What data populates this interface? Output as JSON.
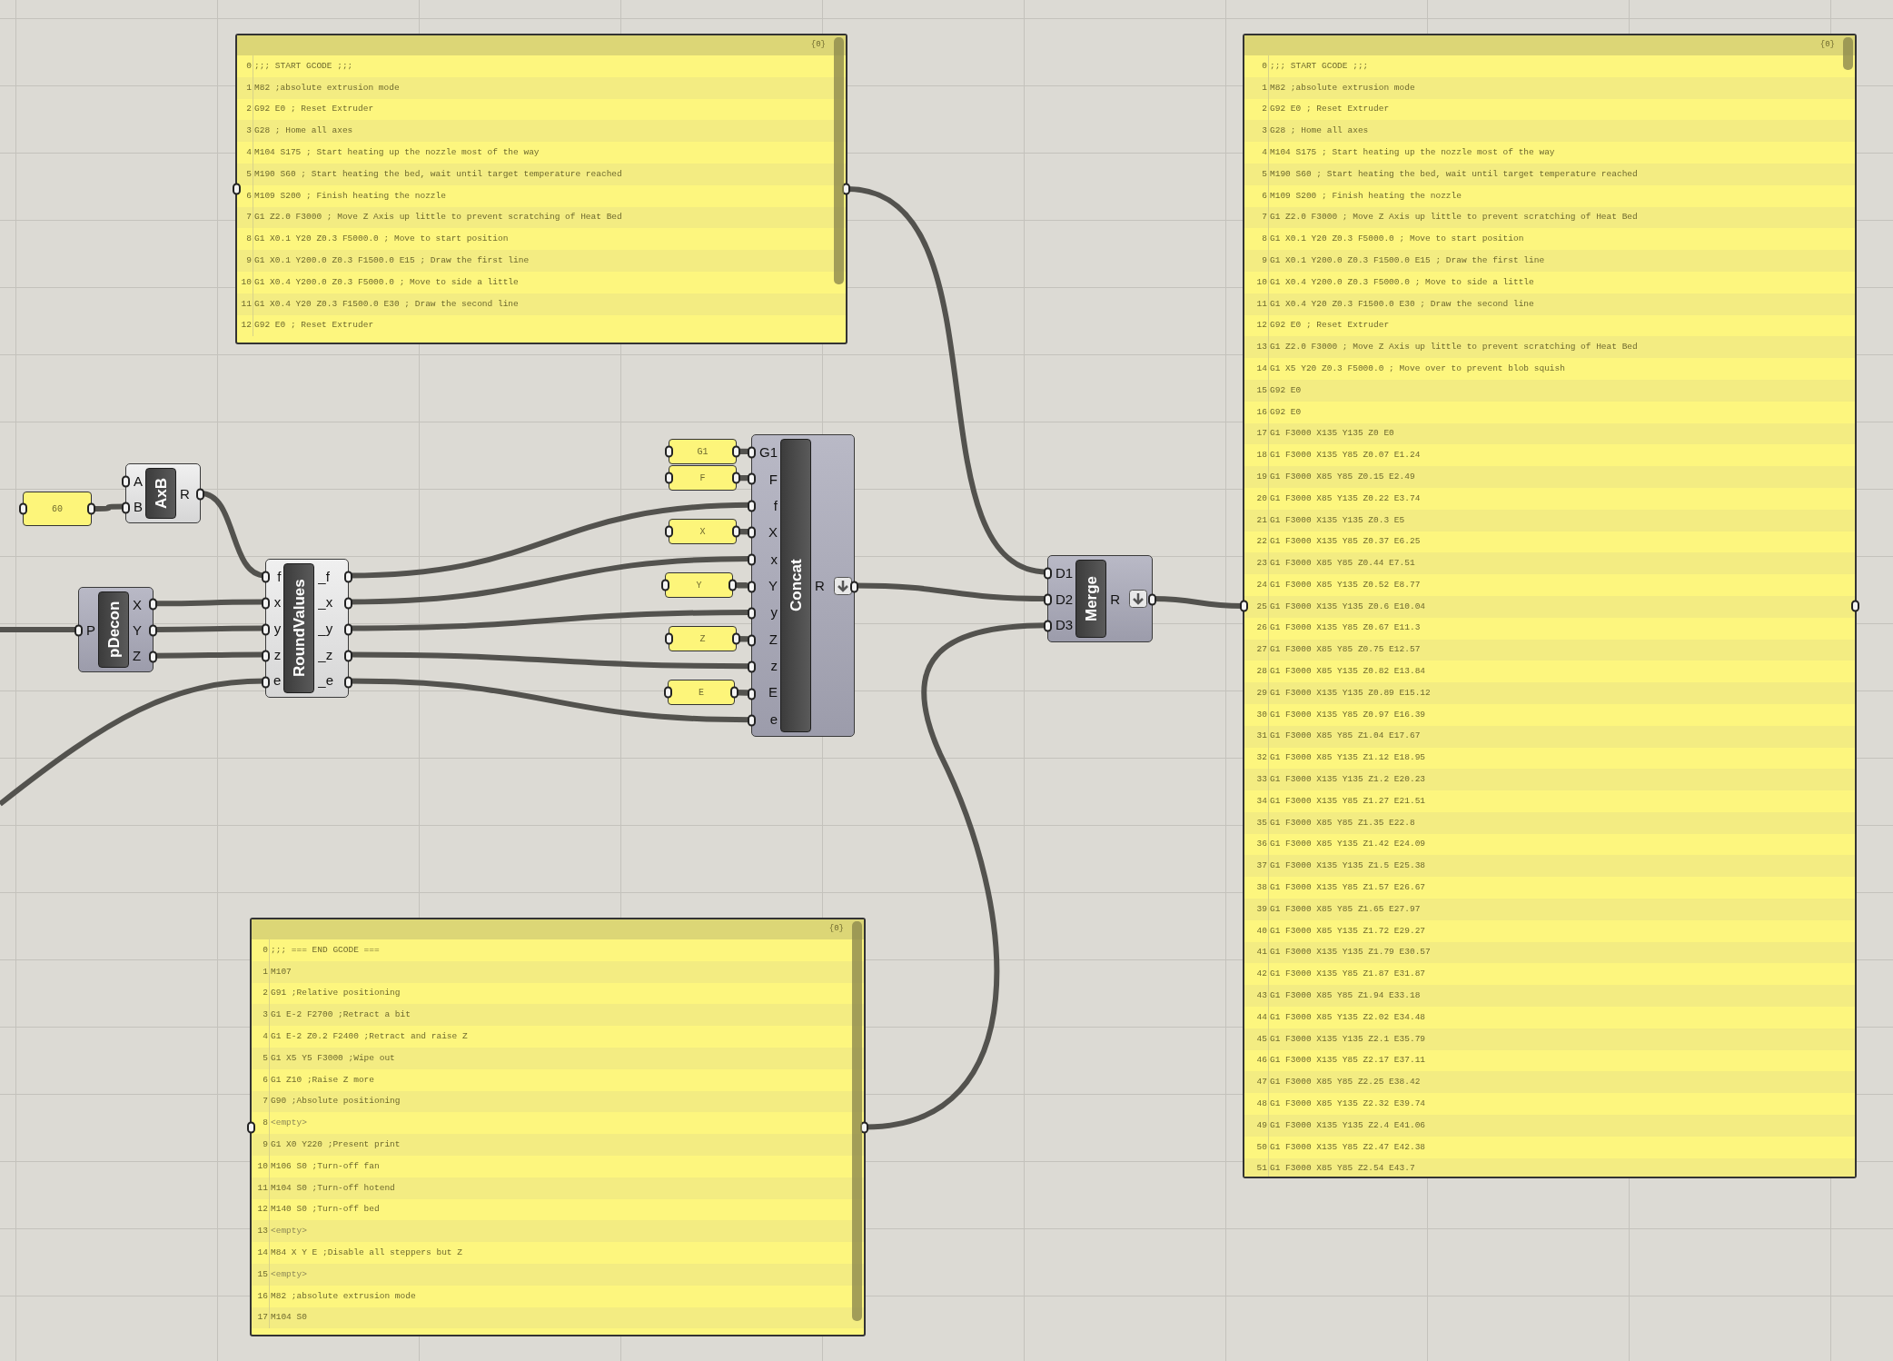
{
  "canvas": {
    "value_panels": [
      {
        "text": "60"
      },
      {
        "text": "G1"
      },
      {
        "text": "F"
      },
      {
        "text": "X"
      },
      {
        "text": "Y"
      },
      {
        "text": "Z"
      },
      {
        "text": "E"
      }
    ],
    "components": [
      {
        "name": "AxB",
        "kind": "light",
        "flatten": false,
        "inputs": [
          "A",
          "B"
        ],
        "outputs": [
          "R"
        ]
      },
      {
        "name": "pDecon",
        "kind": "dark",
        "flatten": false,
        "inputs": [
          "P"
        ],
        "outputs": [
          "X",
          "Y",
          "Z"
        ]
      },
      {
        "name": "RoundValues",
        "kind": "light",
        "flatten": false,
        "inputs": [
          "f",
          "x",
          "y",
          "z",
          "e"
        ],
        "outputs": [
          "_f",
          "_x",
          "_y",
          "_z",
          "_e"
        ]
      },
      {
        "name": "Concat",
        "kind": "dark",
        "flatten": true,
        "inputs": [
          "G1",
          "F",
          "f",
          "X",
          "x",
          "Y",
          "y",
          "Z",
          "z",
          "E",
          "e"
        ],
        "outputs": [
          "R"
        ]
      },
      {
        "name": "Merge",
        "kind": "dark",
        "flatten": true,
        "inputs": [
          "D1",
          "D2",
          "D3"
        ],
        "outputs": [
          "R"
        ]
      }
    ],
    "text_panels": [
      {
        "header": "{0}",
        "lines": [
          {
            "index": "0",
            "text": ";;; START GCODE ;;;",
            "kind": "code"
          },
          {
            "index": "1",
            "text": "M82 ;absolute extrusion mode",
            "kind": "code"
          },
          {
            "index": "2",
            "text": "G92 E0 ; Reset Extruder",
            "kind": "code"
          },
          {
            "index": "3",
            "text": "G28 ; Home all axes",
            "kind": "code"
          },
          {
            "index": "4",
            "text": "M104 S175 ; Start heating up the nozzle most of the way",
            "kind": "code"
          },
          {
            "index": "5",
            "text": "M190 S60 ; Start heating the bed, wait until target temperature reached",
            "kind": "code"
          },
          {
            "index": "6",
            "text": "M109 S200 ; Finish heating the nozzle",
            "kind": "code"
          },
          {
            "index": "7",
            "text": "G1 Z2.0 F3000 ; Move Z Axis up little to prevent scratching of Heat Bed",
            "kind": "code"
          },
          {
            "index": "8",
            "text": "G1 X0.1 Y20 Z0.3 F5000.0 ; Move to start position",
            "kind": "code"
          },
          {
            "index": "9",
            "text": "G1 X0.1 Y200.0 Z0.3 F1500.0 E15 ; Draw the first line",
            "kind": "code"
          },
          {
            "index": "10",
            "text": "G1 X0.4 Y200.0 Z0.3 F5000.0 ; Move to side a little",
            "kind": "code"
          },
          {
            "index": "11",
            "text": "G1 X0.4 Y20 Z0.3 F1500.0 E30 ; Draw the second line",
            "kind": "code"
          },
          {
            "index": "12",
            "text": "G92 E0 ; Reset Extruder",
            "kind": "code"
          }
        ]
      },
      {
        "header": "{0}",
        "lines": [
          {
            "index": "0",
            "text": ";;; START GCODE ;;;",
            "kind": "code"
          },
          {
            "index": "1",
            "text": "M82 ;absolute extrusion mode",
            "kind": "code"
          },
          {
            "index": "2",
            "text": "G92 E0 ; Reset Extruder",
            "kind": "code"
          },
          {
            "index": "3",
            "text": "G28 ; Home all axes",
            "kind": "code"
          },
          {
            "index": "4",
            "text": "M104 S175 ; Start heating up the nozzle most of the way",
            "kind": "code"
          },
          {
            "index": "5",
            "text": "M190 S60 ; Start heating the bed, wait until target temperature reached",
            "kind": "code"
          },
          {
            "index": "6",
            "text": "M109 S200 ; Finish heating the nozzle",
            "kind": "code"
          },
          {
            "index": "7",
            "text": "G1 Z2.0 F3000 ; Move Z Axis up little to prevent scratching of Heat Bed",
            "kind": "code"
          },
          {
            "index": "8",
            "text": "G1 X0.1 Y20 Z0.3 F5000.0 ; Move to start position",
            "kind": "code"
          },
          {
            "index": "9",
            "text": "G1 X0.1 Y200.0 Z0.3 F1500.0 E15 ; Draw the first line",
            "kind": "code"
          },
          {
            "index": "10",
            "text": "G1 X0.4 Y200.0 Z0.3 F5000.0 ; Move to side a little",
            "kind": "code"
          },
          {
            "index": "11",
            "text": "G1 X0.4 Y20 Z0.3 F1500.0 E30 ; Draw the second line",
            "kind": "code"
          },
          {
            "index": "12",
            "text": "G92 E0 ; Reset Extruder",
            "kind": "code"
          },
          {
            "index": "13",
            "text": "G1 Z2.0 F3000 ; Move Z Axis up little to prevent scratching of Heat Bed",
            "kind": "code"
          },
          {
            "index": "14",
            "text": "G1 X5 Y20 Z0.3 F5000.0 ; Move over to prevent blob squish",
            "kind": "code"
          },
          {
            "index": "15",
            "text": "G92 E0",
            "kind": "code"
          },
          {
            "index": "16",
            "text": "G92 E0",
            "kind": "code"
          },
          {
            "index": "17",
            "text": "G1 F3000 X135 Y135 Z0 E0",
            "kind": "code"
          },
          {
            "index": "18",
            "text": "G1 F3000 X135 Y85 Z0.07 E1.24",
            "kind": "code"
          },
          {
            "index": "19",
            "text": "G1 F3000 X85 Y85 Z0.15 E2.49",
            "kind": "code"
          },
          {
            "index": "20",
            "text": "G1 F3000 X85 Y135 Z0.22 E3.74",
            "kind": "code"
          },
          {
            "index": "21",
            "text": "G1 F3000 X135 Y135 Z0.3 E5",
            "kind": "code"
          },
          {
            "index": "22",
            "text": "G1 F3000 X135 Y85 Z0.37 E6.25",
            "kind": "code"
          },
          {
            "index": "23",
            "text": "G1 F3000 X85 Y85 Z0.44 E7.51",
            "kind": "code"
          },
          {
            "index": "24",
            "text": "G1 F3000 X85 Y135 Z0.52 E8.77",
            "kind": "code"
          },
          {
            "index": "25",
            "text": "G1 F3000 X135 Y135 Z0.6 E10.04",
            "kind": "code"
          },
          {
            "index": "26",
            "text": "G1 F3000 X135 Y85 Z0.67 E11.3",
            "kind": "code"
          },
          {
            "index": "27",
            "text": "G1 F3000 X85 Y85 Z0.75 E12.57",
            "kind": "code"
          },
          {
            "index": "28",
            "text": "G1 F3000 X85 Y135 Z0.82 E13.84",
            "kind": "code"
          },
          {
            "index": "29",
            "text": "G1 F3000 X135 Y135 Z0.89 E15.12",
            "kind": "code"
          },
          {
            "index": "30",
            "text": "G1 F3000 X135 Y85 Z0.97 E16.39",
            "kind": "code"
          },
          {
            "index": "31",
            "text": "G1 F3000 X85 Y85 Z1.04 E17.67",
            "kind": "code"
          },
          {
            "index": "32",
            "text": "G1 F3000 X85 Y135 Z1.12 E18.95",
            "kind": "code"
          },
          {
            "index": "33",
            "text": "G1 F3000 X135 Y135 Z1.2 E20.23",
            "kind": "code"
          },
          {
            "index": "34",
            "text": "G1 F3000 X135 Y85 Z1.27 E21.51",
            "kind": "code"
          },
          {
            "index": "35",
            "text": "G1 F3000 X85 Y85 Z1.35 E22.8",
            "kind": "code"
          },
          {
            "index": "36",
            "text": "G1 F3000 X85 Y135 Z1.42 E24.09",
            "kind": "code"
          },
          {
            "index": "37",
            "text": "G1 F3000 X135 Y135 Z1.5 E25.38",
            "kind": "code"
          },
          {
            "index": "38",
            "text": "G1 F3000 X135 Y85 Z1.57 E26.67",
            "kind": "code"
          },
          {
            "index": "39",
            "text": "G1 F3000 X85 Y85 Z1.65 E27.97",
            "kind": "code"
          },
          {
            "index": "40",
            "text": "G1 F3000 X85 Y135 Z1.72 E29.27",
            "kind": "code"
          },
          {
            "index": "41",
            "text": "G1 F3000 X135 Y135 Z1.79 E30.57",
            "kind": "code"
          },
          {
            "index": "42",
            "text": "G1 F3000 X135 Y85 Z1.87 E31.87",
            "kind": "code"
          },
          {
            "index": "43",
            "text": "G1 F3000 X85 Y85 Z1.94 E33.18",
            "kind": "code"
          },
          {
            "index": "44",
            "text": "G1 F3000 X85 Y135 Z2.02 E34.48",
            "kind": "code"
          },
          {
            "index": "45",
            "text": "G1 F3000 X135 Y135 Z2.1 E35.79",
            "kind": "code"
          },
          {
            "index": "46",
            "text": "G1 F3000 X135 Y85 Z2.17 E37.11",
            "kind": "code"
          },
          {
            "index": "47",
            "text": "G1 F3000 X85 Y85 Z2.25 E38.42",
            "kind": "code"
          },
          {
            "index": "48",
            "text": "G1 F3000 X85 Y135 Z2.32 E39.74",
            "kind": "code"
          },
          {
            "index": "49",
            "text": "G1 F3000 X135 Y135 Z2.4 E41.06",
            "kind": "code"
          },
          {
            "index": "50",
            "text": "G1 F3000 X135 Y85 Z2.47 E42.38",
            "kind": "code"
          },
          {
            "index": "51",
            "text": "G1 F3000 X85 Y85 Z2.54 E43.7",
            "kind": "code"
          }
        ]
      },
      {
        "header": "{0}",
        "lines": [
          {
            "index": "0",
            "text": ";;; === END GCODE ===",
            "kind": "code"
          },
          {
            "index": "1",
            "text": "M107",
            "kind": "code"
          },
          {
            "index": "2",
            "text": "G91 ;Relative positioning",
            "kind": "code"
          },
          {
            "index": "3",
            "text": "G1 E-2 F2700 ;Retract a bit",
            "kind": "code"
          },
          {
            "index": "4",
            "text": "G1 E-2 Z0.2 F2400 ;Retract and raise Z",
            "kind": "code"
          },
          {
            "index": "5",
            "text": "G1 X5 Y5 F3000 ;Wipe out",
            "kind": "code"
          },
          {
            "index": "6",
            "text": "G1 Z10 ;Raise Z more",
            "kind": "code"
          },
          {
            "index": "7",
            "text": "G90 ;Absolute positioning",
            "kind": "code"
          },
          {
            "index": "8",
            "text": "<empty>",
            "kind": "empty"
          },
          {
            "index": "9",
            "text": "G1 X0 Y220 ;Present print",
            "kind": "code"
          },
          {
            "index": "10",
            "text": "M106 S0 ;Turn-off fan",
            "kind": "code"
          },
          {
            "index": "11",
            "text": "M104 S0 ;Turn-off hotend",
            "kind": "code"
          },
          {
            "index": "12",
            "text": "M140 S0 ;Turn-off bed",
            "kind": "code"
          },
          {
            "index": "13",
            "text": "<empty>",
            "kind": "empty"
          },
          {
            "index": "14",
            "text": "M84 X Y E ;Disable all steppers but Z",
            "kind": "code"
          },
          {
            "index": "15",
            "text": "<empty>",
            "kind": "empty"
          },
          {
            "index": "16",
            "text": "M82 ;absolute extrusion mode",
            "kind": "code"
          },
          {
            "index": "17",
            "text": "M104 S0",
            "kind": "code"
          }
        ]
      }
    ]
  }
}
